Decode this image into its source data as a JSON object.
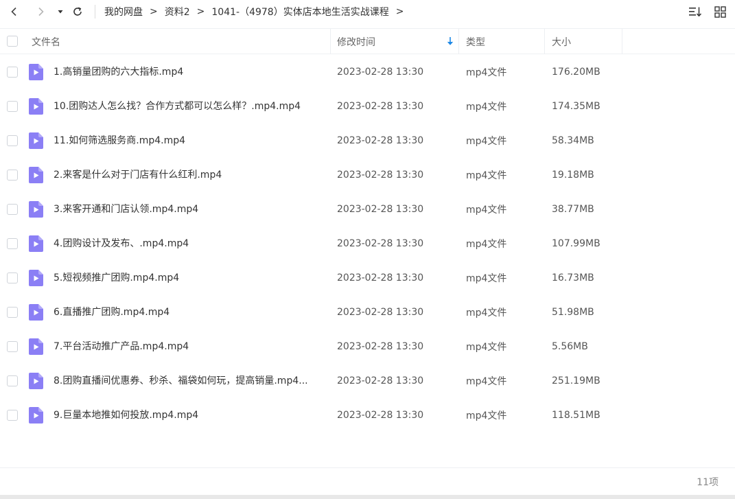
{
  "toolbar": {
    "breadcrumb": [
      "我的网盘",
      "资料2",
      "1041-（4978）实体店本地生活实战课程"
    ],
    "separator": ">"
  },
  "table": {
    "headers": {
      "name": "文件名",
      "modified": "修改时间",
      "type": "类型",
      "size": "大小"
    },
    "sort_column": "modified",
    "sort_direction": "descending",
    "rows": [
      {
        "name": "1.高销量团购的六大指标.mp4",
        "date": "2023-02-28 13:30",
        "type": "mp4文件",
        "size": "176.20MB"
      },
      {
        "name": "10.团购达人怎么找？合作方式都可以怎么样？.mp4.mp4",
        "date": "2023-02-28 13:30",
        "type": "mp4文件",
        "size": "174.35MB"
      },
      {
        "name": "11.如何筛选服务商.mp4.mp4",
        "date": "2023-02-28 13:30",
        "type": "mp4文件",
        "size": "58.34MB"
      },
      {
        "name": "2.来客是什么对于门店有什么红利.mp4",
        "date": "2023-02-28 13:30",
        "type": "mp4文件",
        "size": "19.18MB"
      },
      {
        "name": "3.来客开通和门店认领.mp4.mp4",
        "date": "2023-02-28 13:30",
        "type": "mp4文件",
        "size": "38.77MB"
      },
      {
        "name": "4.团购设计及发布、.mp4.mp4",
        "date": "2023-02-28 13:30",
        "type": "mp4文件",
        "size": "107.99MB"
      },
      {
        "name": "5.短视频推广团购.mp4.mp4",
        "date": "2023-02-28 13:30",
        "type": "mp4文件",
        "size": "16.73MB"
      },
      {
        "name": "6.直播推广团购.mp4.mp4",
        "date": "2023-02-28 13:30",
        "type": "mp4文件",
        "size": "51.98MB"
      },
      {
        "name": "7.平台活动推广产品.mp4.mp4",
        "date": "2023-02-28 13:30",
        "type": "mp4文件",
        "size": "5.56MB"
      },
      {
        "name": "8.团购直播间优惠券、秒杀、福袋如何玩，提高销量.mp4...",
        "date": "2023-02-28 13:30",
        "type": "mp4文件",
        "size": "251.19MB"
      },
      {
        "name": "9.巨量本地推如何投放.mp4.mp4",
        "date": "2023-02-28 13:30",
        "type": "mp4文件",
        "size": "118.51MB"
      }
    ]
  },
  "footer": {
    "item_count": "11项"
  },
  "colors": {
    "file_icon": "#8b7ff5",
    "sort_arrow": "#1e88e5",
    "divider": "#eceef2"
  },
  "icons": {
    "back": "chevron-left-icon",
    "forward": "chevron-right-icon",
    "history": "caret-down-icon",
    "refresh": "refresh-icon",
    "sort_menu": "sort-icon",
    "view_toggle": "grid-view-icon",
    "file": "video-file-icon"
  }
}
